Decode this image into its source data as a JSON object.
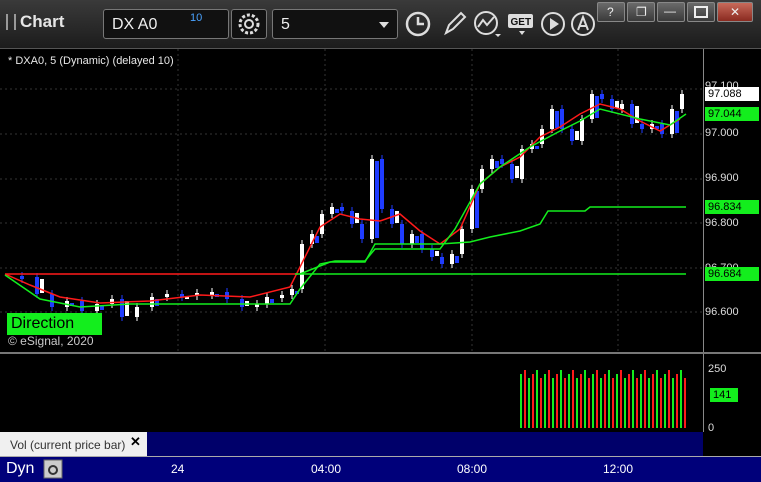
{
  "window": {
    "title": "Chart"
  },
  "toolbar": {
    "symbol": "DX A0",
    "symbol_superscript": "10",
    "interval": "5",
    "icons": [
      "gear-icon",
      "clock-icon",
      "pencil-icon",
      "study-icon",
      "get-icon",
      "play-icon",
      "cursor-icon"
    ],
    "get_label": "GET"
  },
  "window_buttons": [
    "?",
    "❐",
    "—",
    "✕"
  ],
  "study": {
    "label": "* DXA0, 5 (Dynamic) (delayed 10)"
  },
  "direction_label": "Direction",
  "copyright": "© eSignal, 2020",
  "price_axis": {
    "ticks": [
      "97.100",
      "97.000",
      "96.900",
      "96.800",
      "96.700",
      "96.600"
    ],
    "badges": [
      {
        "value": "97.088",
        "color": "#ffffff"
      },
      {
        "value": "97.044",
        "color": "#13ee1d"
      },
      {
        "value": "96.834",
        "color": "#13ee1d"
      },
      {
        "value": "96.684",
        "color": "#13ee1d"
      }
    ]
  },
  "volume_axis": {
    "ticks": [
      "250",
      "0"
    ],
    "badge": {
      "value": "141",
      "color": "#13ee1d"
    }
  },
  "volume_panel": {
    "label": "Vol (current price bar)",
    "close": "✕"
  },
  "time_axis": {
    "dyn": "Dyn",
    "labels": [
      "24",
      "04:00",
      "08:00",
      "12:00"
    ]
  },
  "colors": {
    "up": "#ffffff",
    "down": "#1f3cff",
    "ma_fast": "#ff1a1a",
    "ma_slow": "#13ee1d",
    "vol_up": "#13ee1d",
    "vol_down": "#ff1a1a"
  }
}
